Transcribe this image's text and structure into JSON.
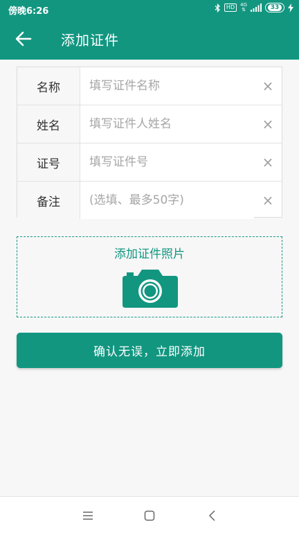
{
  "status_bar": {
    "time": "傍晚6:26",
    "hd": "HD",
    "network_type": "4G",
    "battery": "33"
  },
  "app_bar": {
    "title": "添加证件"
  },
  "form": {
    "fields": [
      {
        "label": "名称",
        "placeholder": "填写证件名称",
        "value": ""
      },
      {
        "label": "姓名",
        "placeholder": "填写证件人姓名",
        "value": ""
      },
      {
        "label": "证号",
        "placeholder": "填写证件号",
        "value": ""
      },
      {
        "label": "备注",
        "placeholder": "(选填、最多50字)",
        "value": ""
      }
    ],
    "clear_glyph": "×"
  },
  "photo_upload": {
    "label": "添加证件照片",
    "icon": "camera-icon"
  },
  "submit": {
    "label": "确认无误，立即添加"
  },
  "colors": {
    "primary": "#129680",
    "background": "#f7f7f7"
  },
  "nav_bar": {
    "icons": [
      "menu-icon",
      "home-icon",
      "back-nav-icon"
    ]
  }
}
